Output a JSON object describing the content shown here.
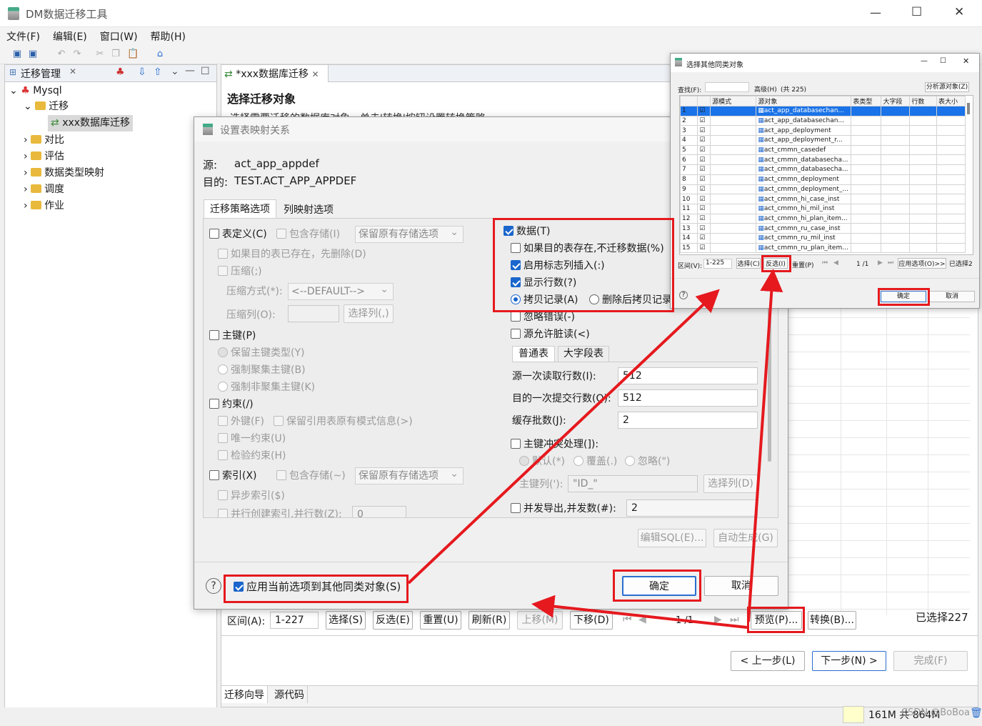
{
  "main_window": {
    "title": "DM数据迁移工具",
    "menu": [
      "文件(F)",
      "编辑(E)",
      "窗口(W)",
      "帮助(H)"
    ],
    "window_buttons": [
      "—",
      "☐",
      "✕"
    ]
  },
  "left_panel": {
    "tab": "迁移管理",
    "tree": {
      "root": "Mysql",
      "migration": "迁移",
      "job": "xxx数据库迁移",
      "items": [
        "对比",
        "评估",
        "数据类型映射",
        "调度",
        "作业"
      ]
    }
  },
  "editor": {
    "tab": "*xxx数据库迁移",
    "heading": "选择迁移对象",
    "subheading": "选择需要迁移的数据库对象，单击'转换'按钮设置转换策略",
    "bottom_bar": {
      "range_label": "区间(A):",
      "range_value": "1-227",
      "buttons": [
        "选择(S)",
        "反选(E)",
        "重置(U)",
        "刷新(R)",
        "上移(M)",
        "下移(D)"
      ],
      "page_text": "1 /1",
      "preview": "预览(P)...",
      "convert": "转换(B)...",
      "selected": "已选择227"
    },
    "wizard": {
      "prev": "< 上一步(L)",
      "next": "下一步(N) >",
      "finish": "完成(F)"
    },
    "bottom_tabs": [
      "迁移向导",
      "源代码"
    ]
  },
  "status_bar": {
    "memory": "161M 共 864M",
    "watermark": "CSDN @BoBoa"
  },
  "dialog": {
    "title": "设置表映射关系",
    "source_label": "源:",
    "source_value": "act_app_appdef",
    "target_label": "目的:",
    "target_value": "TEST.ACT_APP_APPDEF",
    "tabs": [
      "迁移策略选项",
      "列映射选项"
    ],
    "left": {
      "table_def": "表定义(C)",
      "include_storage": "包含存储(I)",
      "storage_option": "保留原有存储选项",
      "drop_if_exists": "如果目的表已存在，先删除(D)",
      "compress": "压缩(;)",
      "compress_mode_label": "压缩方式(*):",
      "compress_mode_value": "<--DEFAULT-->",
      "compress_col_label": "压缩列(O):",
      "select_col": "选择列(,)",
      "primary_key": "主键(P)",
      "pk_keep": "保留主键类型(Y)",
      "pk_cluster": "强制聚集主键(B)",
      "pk_noncluster": "强制非聚集主键(K)",
      "constraint": "约束(/)",
      "foreign_key": "外键(F)",
      "keep_ref_schema": "保留引用表原有模式信息(>)",
      "unique": "唯一约束(U)",
      "check": "检验约束(H)",
      "index": "索引(X)",
      "index_include_storage": "包含存储(~)",
      "index_storage_option": "保留原有存储选项",
      "async_index": "异步索引($)",
      "parallel_index": "并行创建索引,并行数(Z):",
      "parallel_value": "0"
    },
    "right": {
      "data": "数据(T)",
      "skip_if_exists": "如果目的表存在,不迁移数据(%)",
      "identity_insert": "启用标志列插入(:)",
      "show_rows": "显示行数(?)",
      "copy_records": "拷贝记录(A)",
      "delete_then_copy": "删除后拷贝记录",
      "ignore_errors": "忽略错误(-)",
      "dirty_read": "源允许脏读(<)",
      "subtabs": [
        "普通表",
        "大字段表"
      ],
      "read_rows_label": "源一次读取行数(I):",
      "read_rows": "512",
      "commit_rows_label": "目的一次提交行数(Q):",
      "commit_rows": "512",
      "batch_label": "缓存批数(J):",
      "batch": "2",
      "pk_conflict": "主键冲突处理(]):",
      "conflict_default": "默认(*)",
      "conflict_overwrite": "覆盖(.)",
      "conflict_ignore": "忽略(\")",
      "pk_col_label": "主键列('):",
      "pk_col_value": "\"ID_\"",
      "select_col": "选择列(D)",
      "concurrent": "并发导出,并发数(#):",
      "concurrent_value": "2"
    },
    "edit_sql": "编辑SQL(E)...",
    "auto_gen": "自动生成(G)",
    "help": "?",
    "apply_others": "应用当前选项到其他同类对象(S)",
    "ok": "确定",
    "cancel": "取消"
  },
  "popup": {
    "title": "选择其他同类对象",
    "find_label": "查找(F):",
    "advanced": "高级(H)",
    "total": "(共 225)",
    "analyze": "分析源对象(Z)",
    "columns": [
      "源模式",
      "源对象",
      "表类型",
      "大字段",
      "行数",
      "表大小"
    ],
    "rows": [
      "act_app_databasechan...",
      "act_app_databasechan...",
      "act_app_deployment",
      "act_app_deployment_r...",
      "act_cmmn_casedef",
      "act_cmmn_databasecha...",
      "act_cmmn_databasecha...",
      "act_cmmn_deployment",
      "act_cmmn_deployment_...",
      "act_cmmn_hi_case_inst",
      "act_cmmn_hi_mil_inst",
      "act_cmmn_hi_plan_item...",
      "act_cmmn_ru_case_inst",
      "act_cmmn_ru_mil_inst",
      "act_cmmn_ru_plan_item..."
    ],
    "range_label": "区间(V):",
    "range_value": "1-225",
    "select": "选择(C)",
    "invert": "反选(I)",
    "reset": "重置(P)",
    "page": "1 /1",
    "apply_options": "应用选项(O)>>",
    "selected": "已选择2",
    "ok": "确定",
    "cancel": "取消"
  }
}
